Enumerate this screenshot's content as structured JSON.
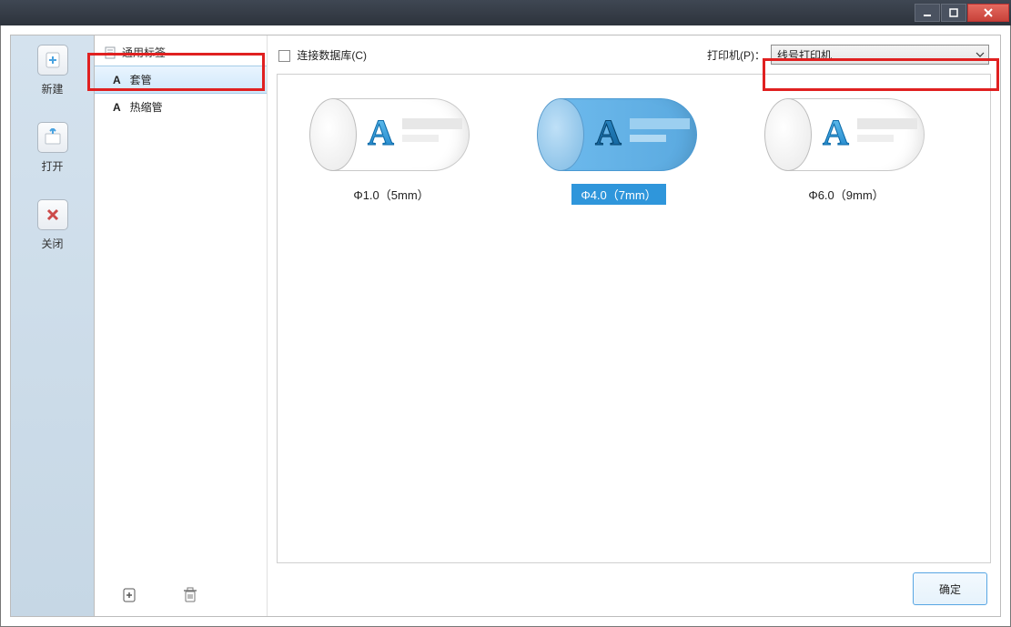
{
  "window": {
    "minimize": "minimize",
    "maximize": "maximize",
    "close": "close"
  },
  "sidebar": {
    "new": "新建",
    "open": "打开",
    "close": "关闭"
  },
  "categories": {
    "header": "通用标签",
    "items": [
      {
        "glyph": "A",
        "label": "套管",
        "selected": true
      },
      {
        "glyph": "A",
        "label": "热缩管",
        "selected": false
      }
    ]
  },
  "toolbar": {
    "connect_db": "连接数据库(C)",
    "printer_label": "打印机(P)：",
    "printer_selected": "线号打印机"
  },
  "thumbnails": [
    {
      "caption": "Φ1.0（5mm）",
      "selected": false
    },
    {
      "caption": "Φ4.0（7mm）",
      "selected": true
    },
    {
      "caption": "Φ6.0（9mm）",
      "selected": false
    }
  ],
  "footer": {
    "ok": "确定"
  },
  "icons": {
    "add_page": "add-page-icon",
    "trash": "trash-icon"
  }
}
